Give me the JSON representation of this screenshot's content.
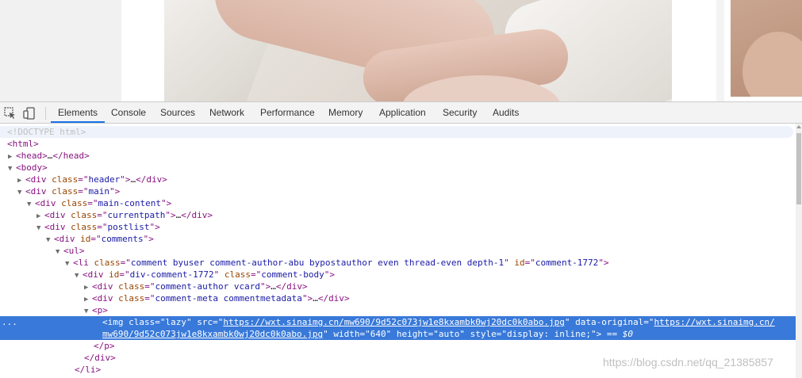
{
  "devtools": {
    "tabs": [
      "Elements",
      "Console",
      "Sources",
      "Network",
      "Performance",
      "Memory",
      "Application",
      "Security",
      "Audits"
    ],
    "active_tab": "Elements",
    "dom": {
      "doctype": "<!DOCTYPE html>",
      "html": "html",
      "head": "head",
      "body": "body",
      "header_class": "header",
      "main_class": "main",
      "main_content_class": "main-content",
      "currentpath_class": "currentpath",
      "postlist_class": "postlist",
      "comments_id": "comments",
      "ul": "ul",
      "li_class": "comment byuser comment-author-abu bypostauthor even thread-even depth-1",
      "li_id": "comment-1772",
      "div_id": "div-comment-1772",
      "div_class": "comment-body",
      "vcard_class": "comment-author vcard",
      "meta_class": "comment-meta commentmetadata",
      "p": "p",
      "img_class": "lazy",
      "img_src": "https://wxt.sinaimg.cn/mw690/9d52c073jw1e8kxambk0wj20dc0k0abo.jpg",
      "img_data_original_1": "https://wxt.sinaimg.cn/",
      "img_data_original_2": "mw690/9d52c073jw1e8kxambk0wj20dc0k0abo.jpg",
      "img_width": "640",
      "img_height": "auto",
      "img_style": "display: inline;",
      "eq_marker": "== $0",
      "ellipsis": "…",
      "selected_dots": "..."
    }
  },
  "watermark": "https://blog.csdn.net/qq_21385857"
}
